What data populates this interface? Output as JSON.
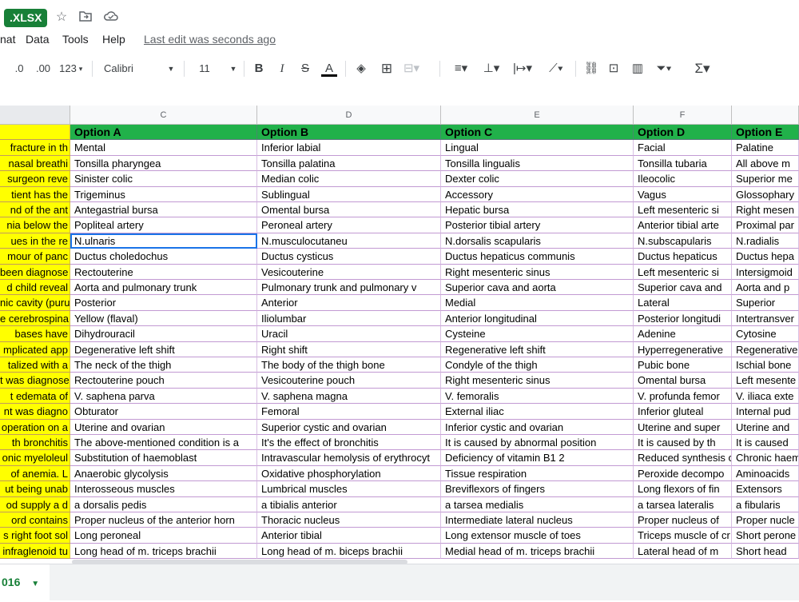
{
  "title_badge": ".XLSX",
  "menu": [
    "nat",
    "Data",
    "Tools",
    "Help"
  ],
  "last_edit": "Last edit was seconds ago",
  "toolbar": {
    "decimal_less": ".0",
    "decimal_more": ".00",
    "format_more": "123",
    "font": "Calibri",
    "font_size": "11",
    "bold": "B",
    "italic": "I",
    "strike": "S",
    "text_color": "A"
  },
  "columns": [
    "C",
    "D",
    "E",
    "F"
  ],
  "header_row": [
    "Option A",
    "Option B",
    "Option C",
    "Option D",
    "Option E"
  ],
  "rows": [
    [
      "fracture in th",
      "Mental",
      "Inferior labial",
      "Lingual",
      "Facial",
      "Palatine"
    ],
    [
      "nasal breathi",
      "Tonsilla pharyngea",
      "Tonsilla palatina",
      "Tonsilla lingualis",
      "Tonsilla tubaria",
      "All above m"
    ],
    [
      "surgeon reve",
      "Sinister colic",
      "Median colic",
      "Dexter colic",
      "Ileocolic",
      "Superior me"
    ],
    [
      "tient has the",
      "Trigeminus",
      "Sublingual",
      "Accessory",
      "Vagus",
      "Glossophary"
    ],
    [
      "nd of the ant",
      "Antegastrial bursa",
      "Omental bursa",
      "Hepatic bursa",
      "Left mesenteric si",
      "Right mesen"
    ],
    [
      "nia below the",
      "Popliteal artery",
      "Peroneal artery",
      "Posterior tibial artery",
      "Anterior tibial arte",
      "Proximal par"
    ],
    [
      "ues in the re",
      "N.ulnaris",
      "N.musculocutaneu",
      "N.dorsalis scapularis",
      "N.subscapularis",
      "N.radialis"
    ],
    [
      "mour of panc",
      "Ductus choledochus",
      "Ductus cysticus",
      "Ductus hepaticus communis",
      "Ductus hepaticus",
      "Ductus hepa"
    ],
    [
      "been diagnose",
      "Rectouterine",
      "Vesicouterine",
      "Right mesenteric sinus",
      "Left mesenteric si",
      "Intersigmoid"
    ],
    [
      "d child reveal",
      "Aorta and pulmonary trunk",
      "Pulmonary trunk and pulmonary v",
      "Superior cava and aorta",
      "Superior cava and",
      "Aorta and p"
    ],
    [
      "nic cavity (puru",
      "Posterior",
      "Anterior",
      "Medial",
      "Lateral",
      "Superior"
    ],
    [
      "e cerebrospina",
      "Yellow (flaval)",
      "Iliolumbar",
      "Anterior longitudinal",
      "Posterior longitudi",
      "Intertransver"
    ],
    [
      "bases have",
      "Dihydrouracil",
      "Uracil",
      "Cysteine",
      "Adenine",
      "Cytosine"
    ],
    [
      "mplicated app",
      "Degenerative left shift",
      "Right shift",
      "Regenerative left shift",
      "Hyperregenerative",
      "Regenerative"
    ],
    [
      "talized with a",
      "The neck of the thigh",
      "The body of the thigh bone",
      "Condyle of the thigh",
      "Pubic bone",
      "Ischial bone"
    ],
    [
      "t was diagnose",
      "Rectouterine pouch",
      "Vesicouterine pouch",
      "Right mesenteric sinus",
      "Omental bursa",
      "Left mesente"
    ],
    [
      "t edemata of",
      "V. saphena parva",
      "V. saphena magna",
      "V. femoralis",
      "V. profunda femor",
      "V. iliaca exte"
    ],
    [
      "nt was diagno",
      "Obturator",
      "Femoral",
      "External iliac",
      "Inferior gluteal",
      "Internal pud"
    ],
    [
      "operation on a",
      "Uterine and ovarian",
      "Superior cystic and ovarian",
      "Inferior cystic and ovarian",
      "Uterine and super",
      "Uterine and"
    ],
    [
      "th bronchitis",
      "The above-mentioned condition is a",
      "It's the effect of bronchitis",
      "It is caused by abnormal position",
      "It is caused by th",
      "It is caused"
    ],
    [
      "onic myeloleul",
      "Substitution of haemoblast",
      "Intravascular hemolysis of erythrocyt",
      "Deficiency of vitamin B1 2",
      "Reduced synthesis o",
      "Chronic haem"
    ],
    [
      "of anemia. L",
      "Anaerobic glycolysis",
      "Oxidative phosphorylation",
      "Tissue respiration",
      "Peroxide decompo",
      "Aminoacids"
    ],
    [
      "ut being unab",
      "Interosseous muscles",
      "Lumbrical muscles",
      "Breviflexors of fingers",
      "Long flexors of fin",
      "Extensors"
    ],
    [
      "od supply a d",
      "a dorsalis pedis",
      "a tibialis anterior",
      "a tarsea medialis",
      "a tarsea lateralis",
      "a fibularis"
    ],
    [
      "ord contains",
      "Proper nucleus of the anterior horn",
      "Thoracic nucleus",
      "Intermediate lateral nucleus",
      "Proper nucleus of",
      "Proper nucle"
    ],
    [
      "s right foot sol",
      "Long peroneal",
      "Anterior tibial",
      "Long extensor muscle of toes",
      "Triceps muscle of cr",
      "Short perone"
    ],
    [
      "infraglenoid tu",
      "Long head of m. triceps brachii",
      "Long head of m. biceps brachii",
      "Medial head of m. triceps brachii",
      "Lateral head of m",
      "Short head"
    ]
  ],
  "sheet_tab": "016",
  "colors": {
    "header_green": "#21b14a",
    "highlight_yellow": "#ffff00",
    "brand_green": "#188038"
  }
}
